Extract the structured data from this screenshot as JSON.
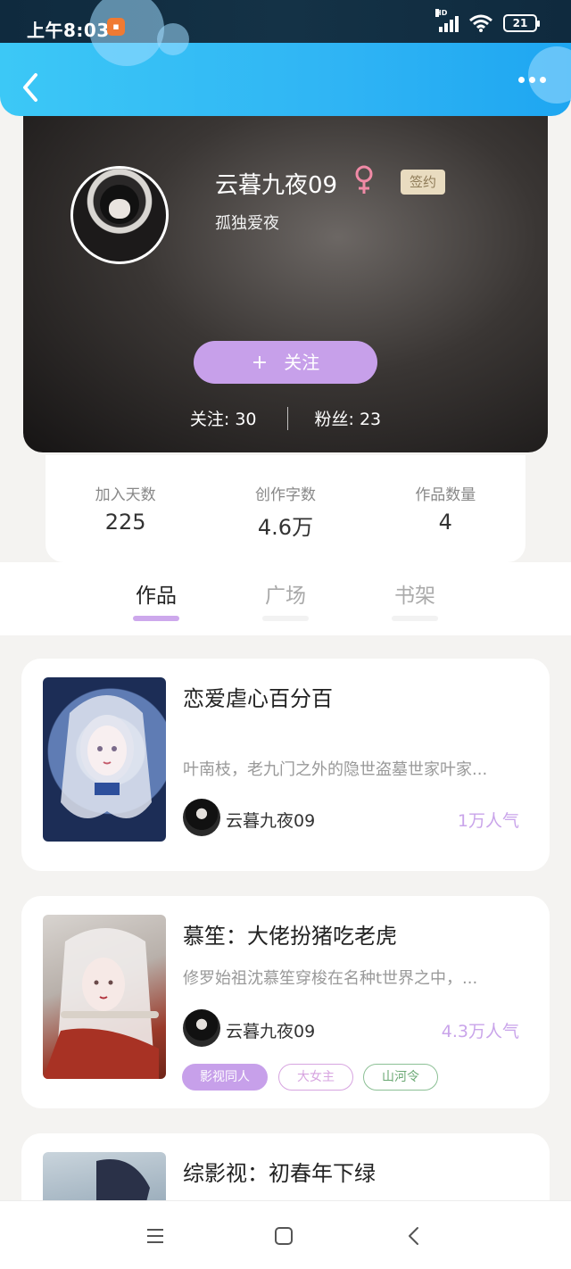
{
  "status_bar": {
    "time": "上午8:03",
    "network": "HD",
    "battery": "21"
  },
  "header": {
    "back_icon": "chevron-left-icon",
    "more_icon": "more-dots-icon"
  },
  "profile": {
    "nickname": "云暮九夜09",
    "gender_icon": "female-icon",
    "badge": "签约",
    "bio": "孤独爱夜",
    "follow_button": "关注",
    "following_label": "关注: 30",
    "fans_label": "粉丝: 23"
  },
  "stats": [
    {
      "label": "加入天数",
      "value": "225"
    },
    {
      "label": "创作字数",
      "value": "4.6万"
    },
    {
      "label": "作品数量",
      "value": "4"
    }
  ],
  "tabs": [
    {
      "label": "作品",
      "active": true
    },
    {
      "label": "广场",
      "active": false
    },
    {
      "label": "书架",
      "active": false
    }
  ],
  "books": [
    {
      "title": "恋爱虐心百分百",
      "description": "叶南枝，老九门之外的隐世盗墓世家叶家...",
      "author": "云暮九夜09",
      "popularity": "1万人气",
      "tags": []
    },
    {
      "title": "慕笙：大佬扮猪吃老虎",
      "description": "修罗始祖沈慕笙穿梭在名种t世界之中，...",
      "author": "云暮九夜09",
      "popularity": "4.3万人气",
      "tags": [
        "影视同人",
        "大女主",
        "山河令"
      ]
    },
    {
      "title": "综影视：初春年下绿"
    }
  ],
  "colors": {
    "accent": "#c7a0ea",
    "header_blue": "#2fb4f4",
    "badge_bg": "#e9dcc0"
  }
}
